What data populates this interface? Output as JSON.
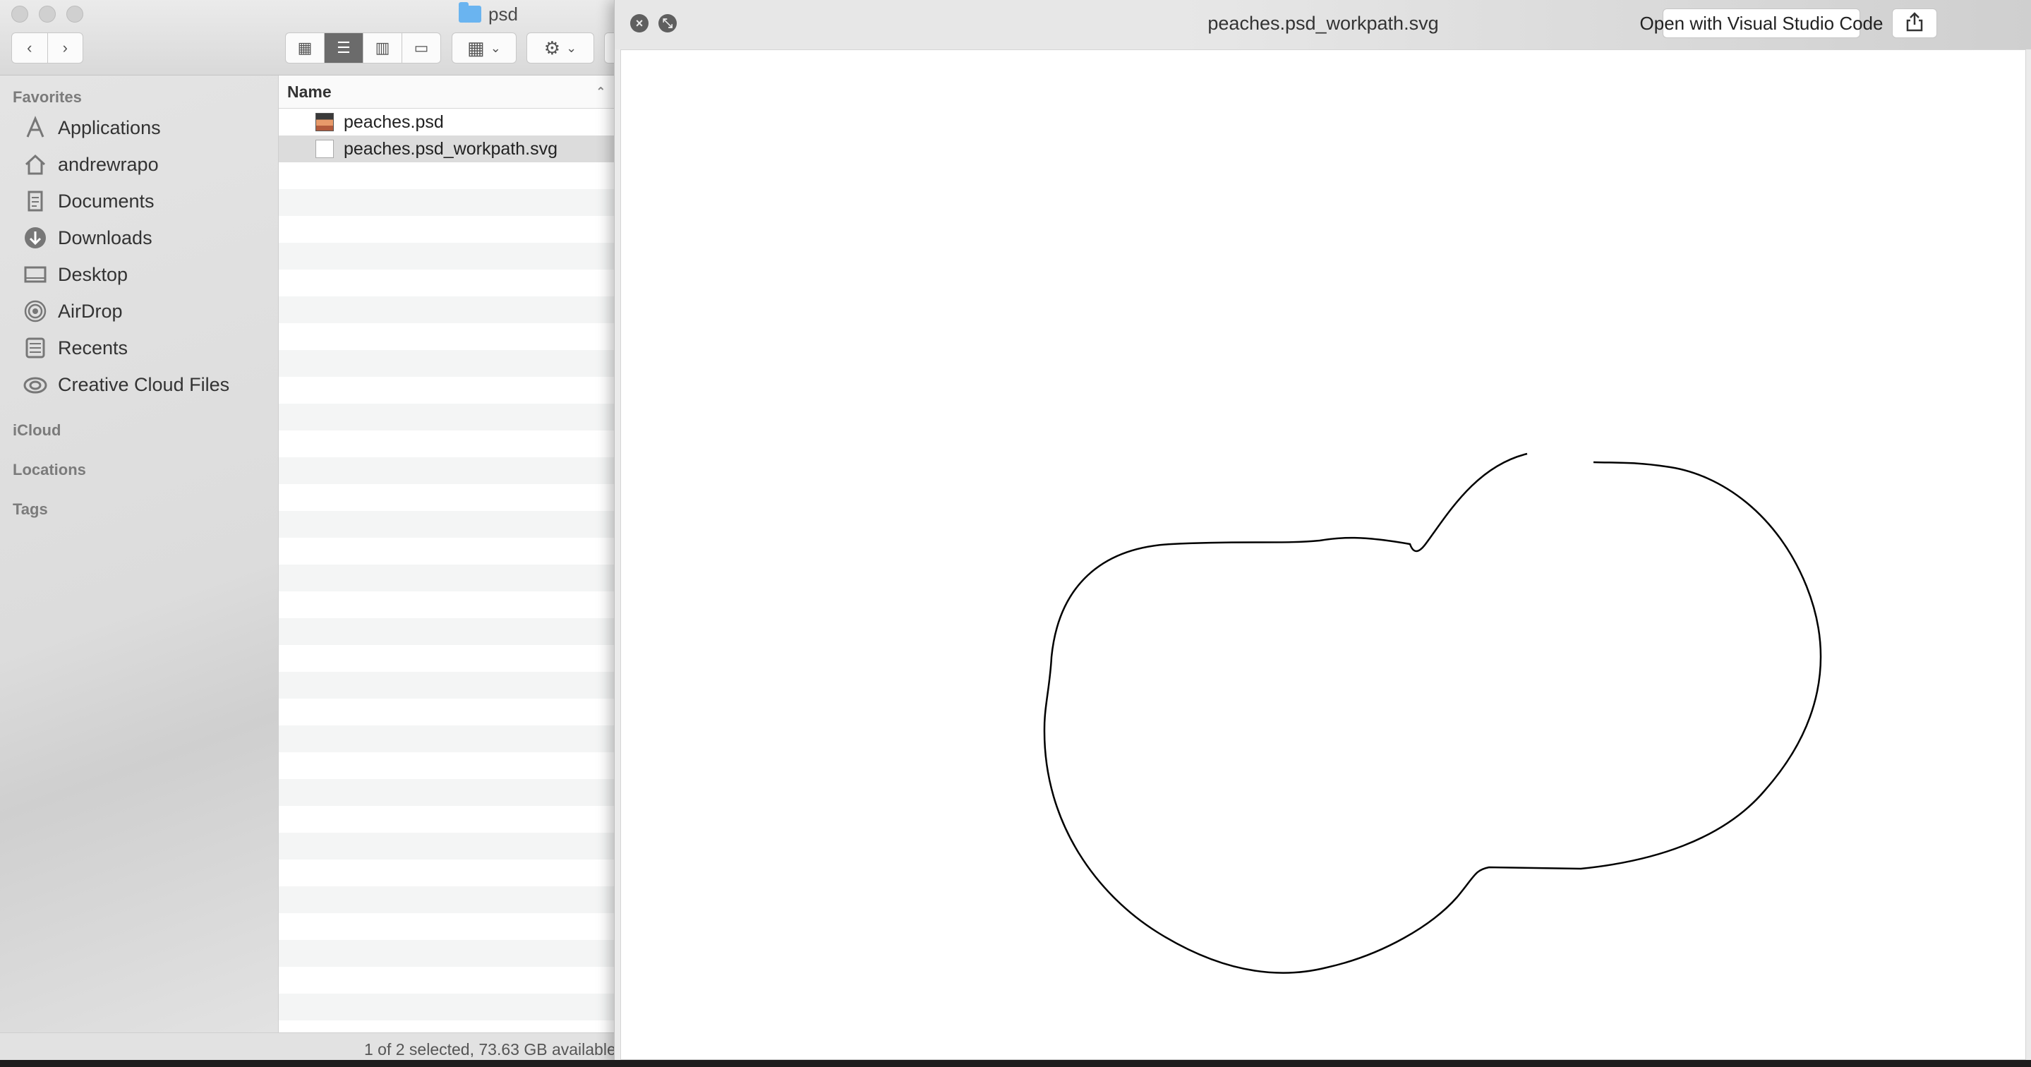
{
  "finder": {
    "title": "psd",
    "sidebar": {
      "favorites_heading": "Favorites",
      "items": [
        {
          "label": "Applications"
        },
        {
          "label": "andrewrapo"
        },
        {
          "label": "Documents"
        },
        {
          "label": "Downloads"
        },
        {
          "label": "Desktop"
        },
        {
          "label": "AirDrop"
        },
        {
          "label": "Recents"
        },
        {
          "label": "Creative Cloud Files"
        }
      ],
      "icloud_heading": "iCloud",
      "locations_heading": "Locations",
      "tags_heading": "Tags"
    },
    "list": {
      "column_name": "Name",
      "files": [
        {
          "name": "peaches.psd",
          "selected": false
        },
        {
          "name": "peaches.psd_workpath.svg",
          "selected": true
        }
      ]
    },
    "status": "1 of 2 selected, 73.63 GB available"
  },
  "quicklook": {
    "title": "peaches.psd_workpath.svg",
    "open_button": "Open with Visual Studio Code",
    "icons": {
      "close": "close-icon",
      "fullscreen": "fullscreen-icon",
      "share": "share-icon"
    }
  }
}
